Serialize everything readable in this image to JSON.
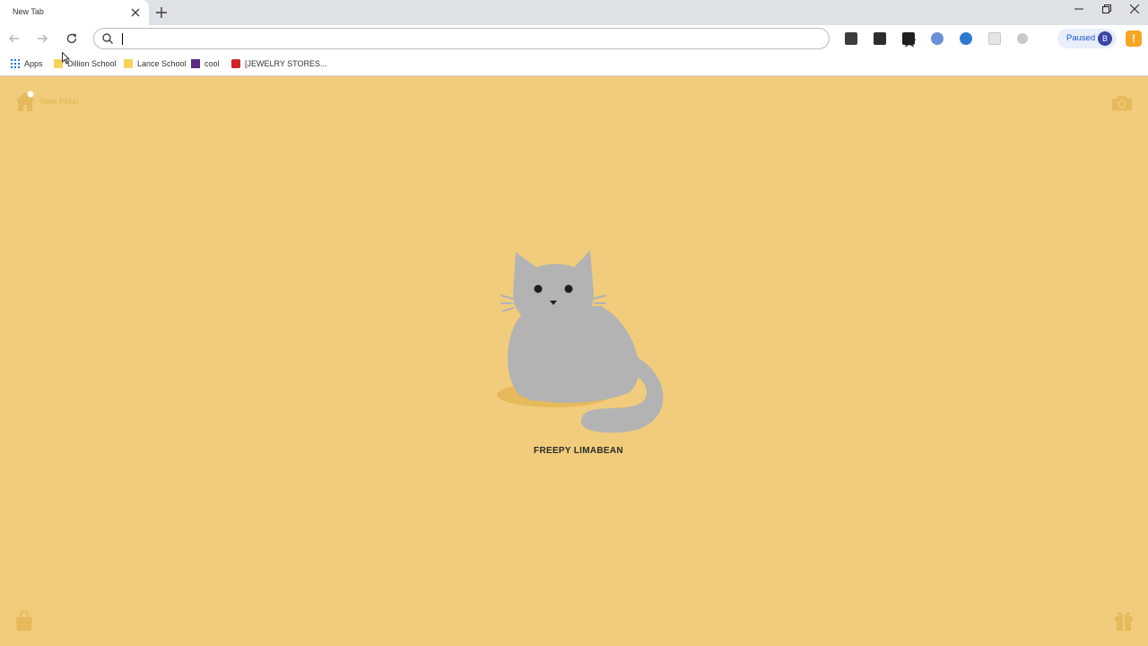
{
  "browser": {
    "tab": {
      "title": "New Tab"
    },
    "omnibox": {
      "value": "",
      "placeholder": ""
    },
    "profile": {
      "status": "Paused",
      "initial": "B"
    },
    "bookmarks": [
      {
        "label": "Apps",
        "icon": "apps-grid-icon"
      },
      {
        "label": "Dillion School",
        "icon": "folder-icon"
      },
      {
        "label": "Lance School",
        "icon": "folder-icon"
      },
      {
        "label": "cool",
        "icon": "site-favicon-icon"
      },
      {
        "label": "[JEWELRY STORES...",
        "icon": "site-favicon-icon"
      }
    ],
    "alert_symbol": "!"
  },
  "page": {
    "home_label": "New Pets!",
    "pet_name": "FREEPY LIMABEAN"
  },
  "colors": {
    "page_background": "#f0cc7c",
    "pet_body": "#b3b3b3",
    "accent_faded": "#e6b95a"
  }
}
